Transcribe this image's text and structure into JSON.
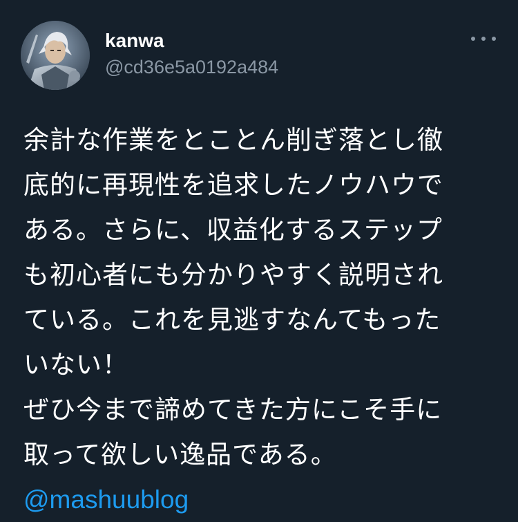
{
  "author": {
    "display_name": "kanwa",
    "handle": "@cd36e5a0192a484"
  },
  "icons": {
    "avatar": "profile-avatar-armored-warrior",
    "more": "more-horizontal-icon"
  },
  "tweet": {
    "lines": [
      "余計な作業をとことん削ぎ落とし徹",
      "底的に再現性を追求したノウハウで",
      "ある。さらに、収益化するステップ",
      "も初心者にも分かりやすく説明され",
      "ている。これを見逃すなんてもった",
      "いない！",
      "ぜひ今まで諦めてきた方にこそ手に",
      "取って欲しい逸品である。"
    ],
    "mention": "@mashuublog"
  },
  "colors": {
    "background": "#15202b",
    "text": "#ffffff",
    "secondary": "#8b98a5",
    "link": "#1d9bf0"
  }
}
